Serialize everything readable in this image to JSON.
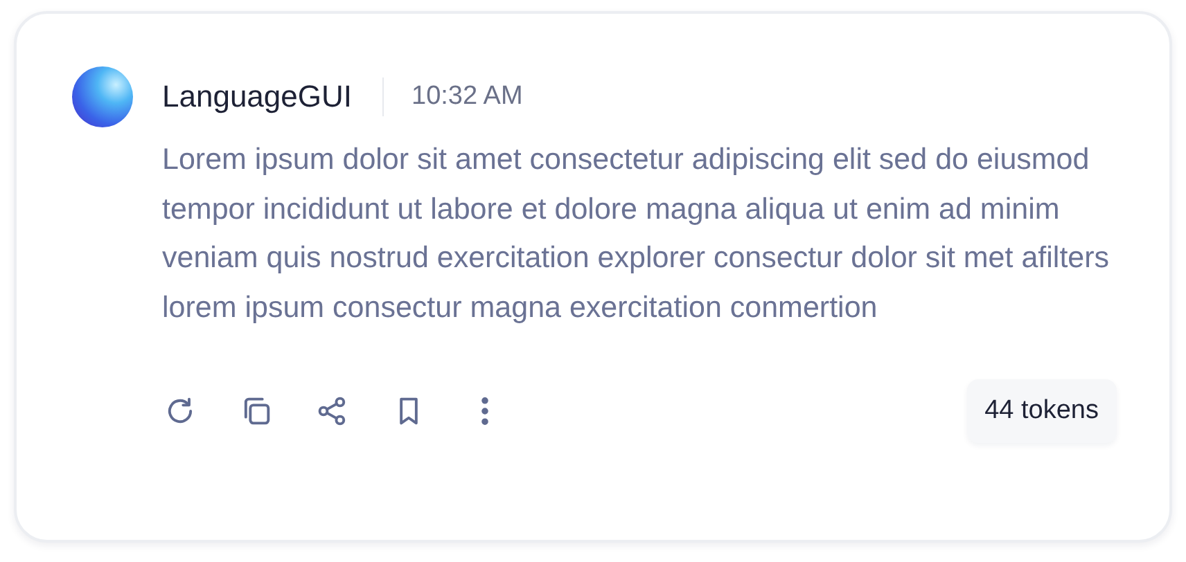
{
  "message": {
    "author": "LanguageGUI",
    "time": "10:32 AM",
    "text": "Lorem ipsum dolor sit amet consectetur adipiscing elit sed do eiusmod tempor incididunt ut labore et dolore magna aliqua ut enim ad minim veniam quis nostrud exercitation explorer consectur dolor sit met afilters lorem ipsum consectur magna exercitation conmertion",
    "actions": [
      {
        "kind": "regenerate"
      },
      {
        "kind": "copy"
      },
      {
        "kind": "share"
      },
      {
        "kind": "bookmark"
      },
      {
        "kind": "more"
      }
    ],
    "tokens": "44 tokens"
  }
}
